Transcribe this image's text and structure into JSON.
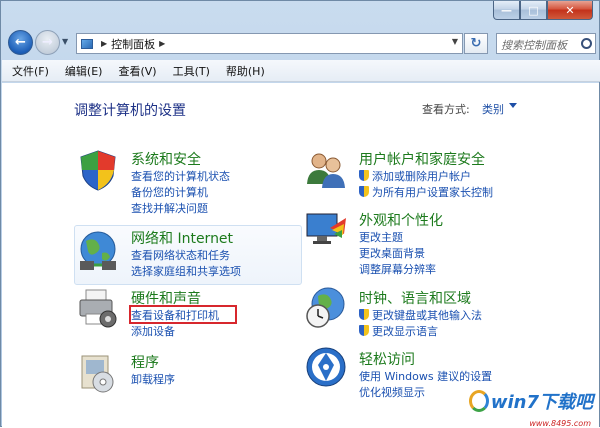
{
  "breadcrumb": {
    "item": "控制面板"
  },
  "search": {
    "placeholder": "搜索控制面板"
  },
  "menu": [
    "文件(F)",
    "编辑(E)",
    "查看(V)",
    "工具(T)",
    "帮助(H)"
  ],
  "page": {
    "title": "调整计算机的设置",
    "view_by_label": "查看方式:",
    "view_by_value": "类别"
  },
  "categories": {
    "system": {
      "title": "系统和安全",
      "links": [
        "查看您的计算机状态",
        "备份您的计算机",
        "查找并解决问题"
      ]
    },
    "network": {
      "title": "网络和 Internet",
      "links": [
        "查看网络状态和任务",
        "选择家庭组和共享选项"
      ]
    },
    "hardware": {
      "title": "硬件和声音",
      "links": [
        "查看设备和打印机",
        "添加设备"
      ]
    },
    "programs": {
      "title": "程序",
      "links": [
        "卸载程序"
      ]
    },
    "users": {
      "title": "用户帐户和家庭安全",
      "links": [
        "添加或删除用户帐户",
        "为所有用户设置家长控制"
      ]
    },
    "appearance": {
      "title": "外观和个性化",
      "links": [
        "更改主题",
        "更改桌面背景",
        "调整屏幕分辨率"
      ]
    },
    "clock": {
      "title": "时钟、语言和区域",
      "links": [
        "更改键盘或其他输入法",
        "更改显示语言"
      ]
    },
    "ease": {
      "title": "轻松访问",
      "links": [
        "使用 Windows 建议的设置",
        "优化视频显示"
      ]
    }
  },
  "watermark": {
    "text": "win7下载吧",
    "url": "www.8495.com"
  }
}
